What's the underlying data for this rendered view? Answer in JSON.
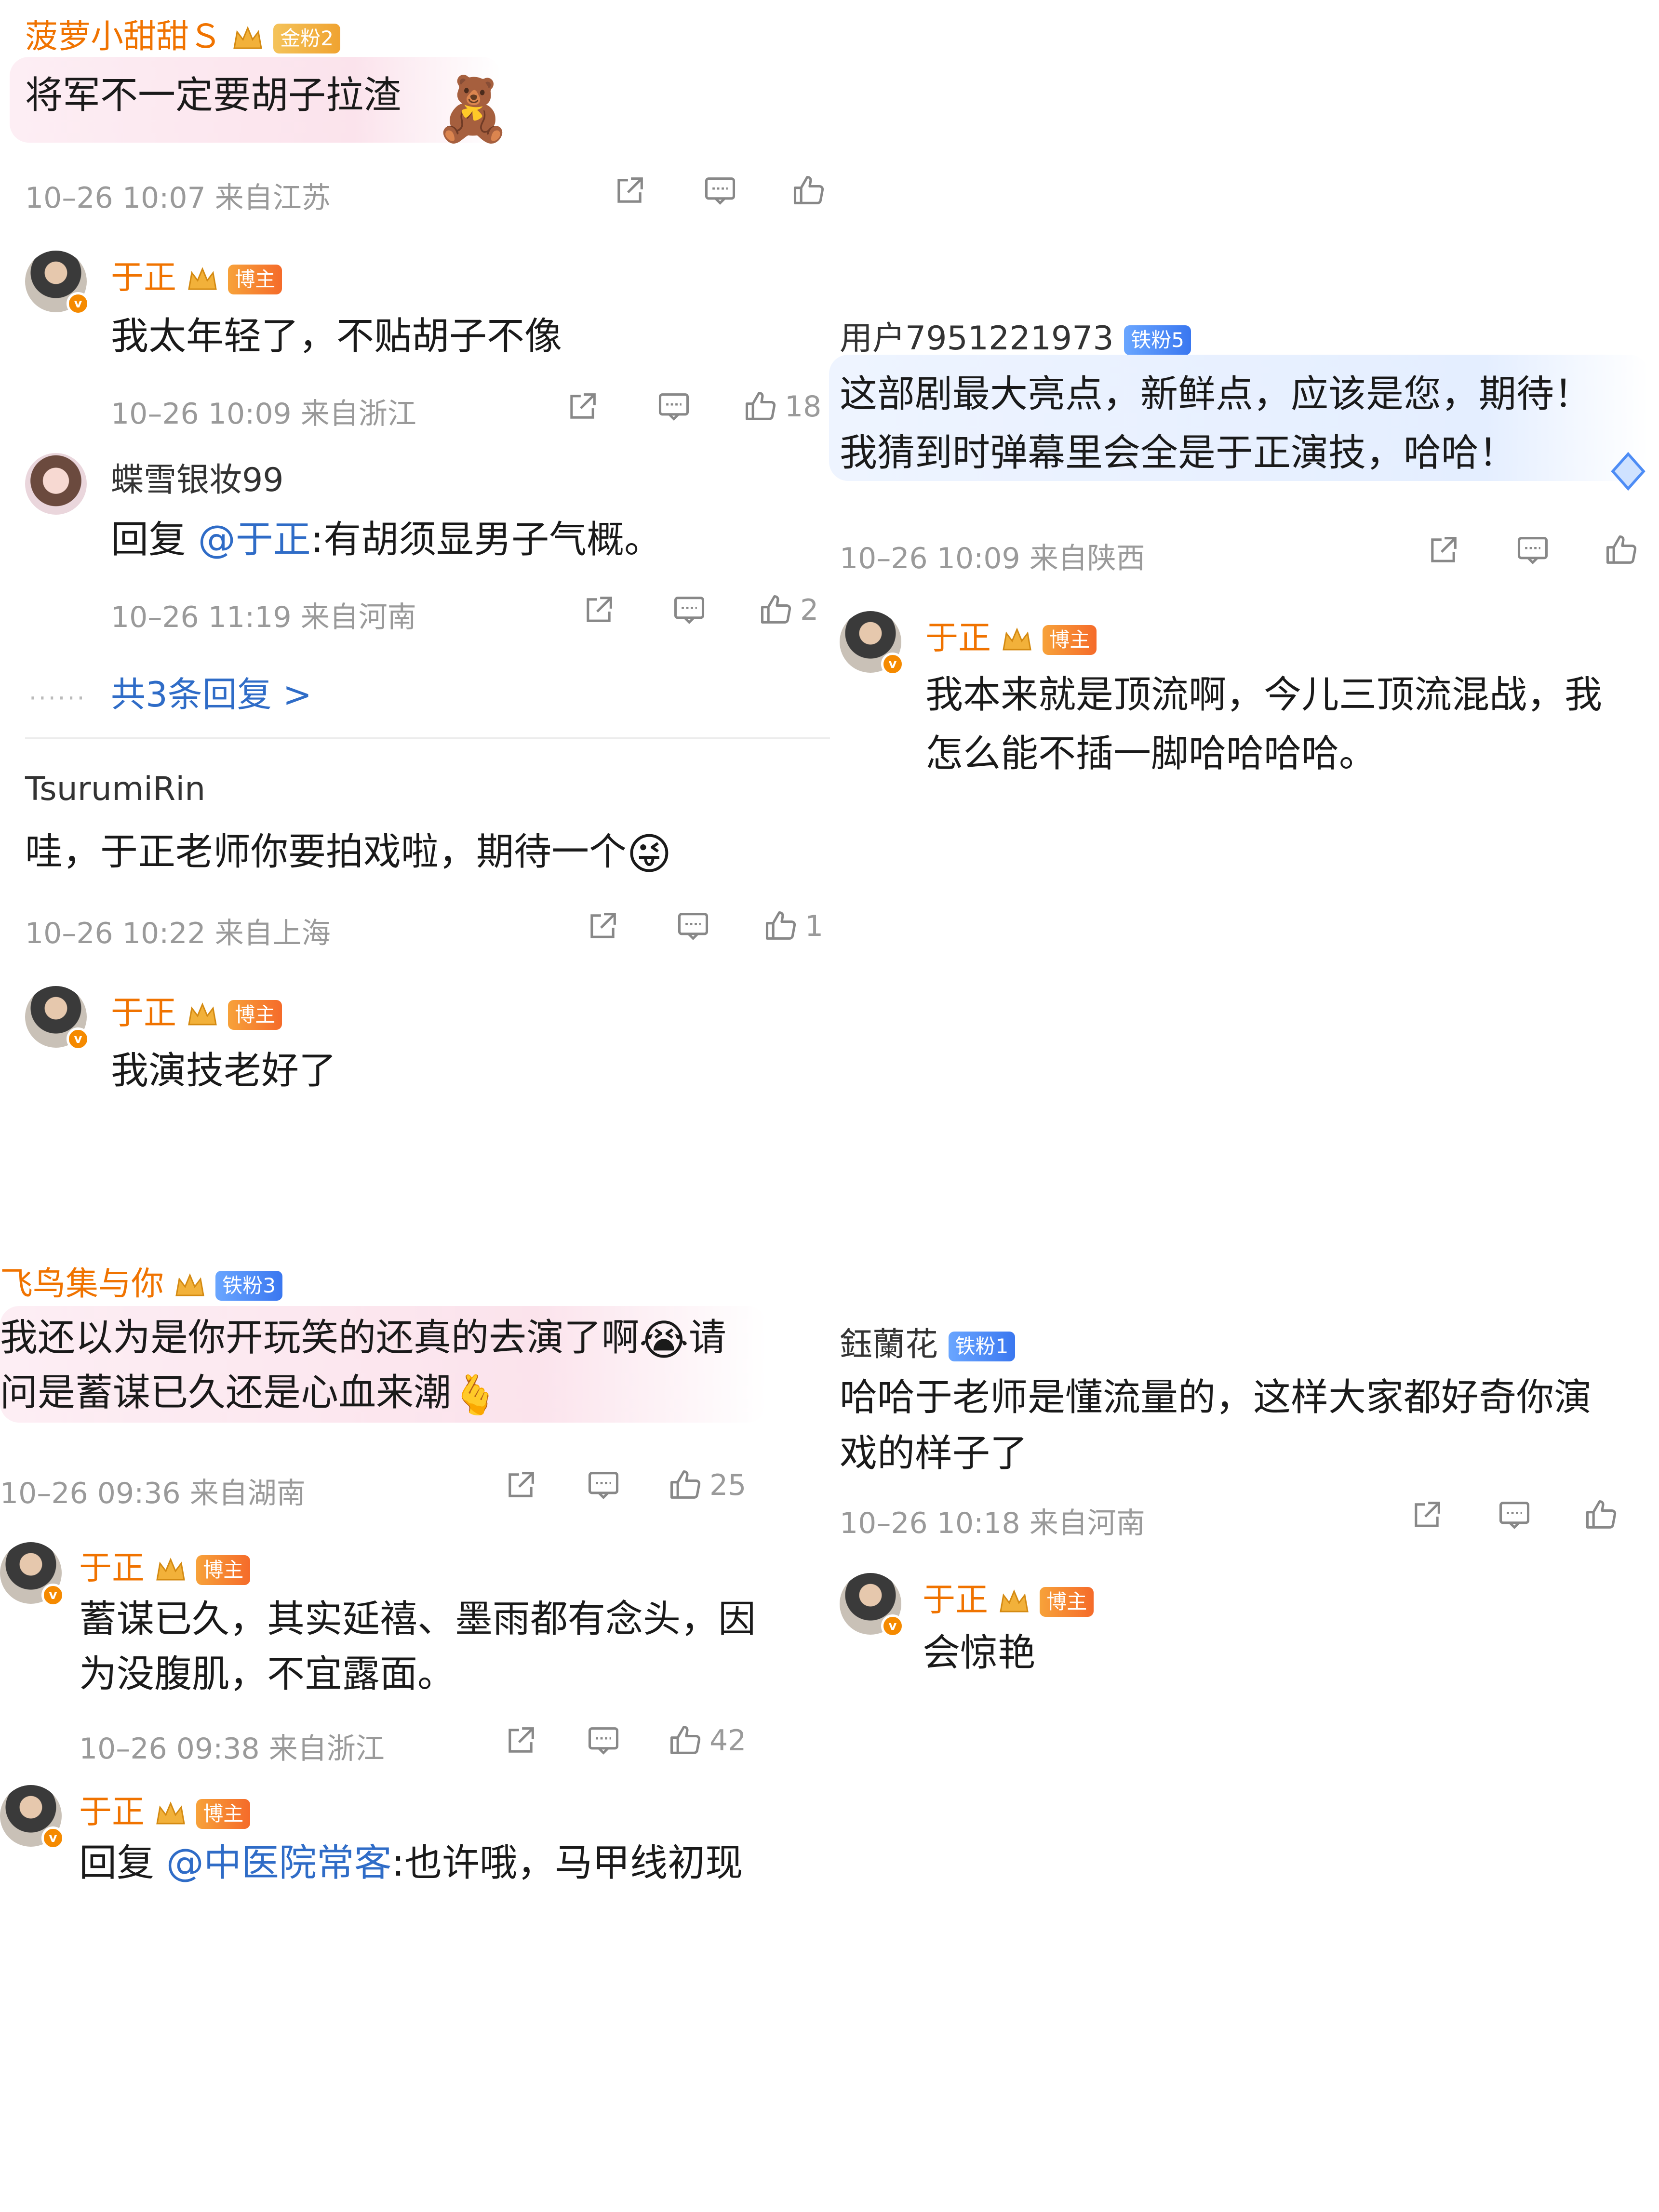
{
  "colors": {
    "name_orange": "#f07300",
    "mention_blue": "#2f6cc7",
    "meta_gray": "#9a9a9a",
    "vip_orange": "#f58a00"
  },
  "icons": [
    "share-icon",
    "comment-icon",
    "like-icon",
    "crown-icon",
    "verified-icon"
  ],
  "c1": {
    "user": "菠萝小甜甜Ｓ",
    "badge": "金粉2",
    "text": "将军不一定要胡子拉渣",
    "meta": "10–26 10:07 来自江苏",
    "reply1": {
      "user": "于正",
      "badge": "博主",
      "text": "我太年轻了，不贴胡子不像",
      "meta": "10–26 10:09 来自浙江",
      "likes": "18"
    },
    "reply2": {
      "user": "蝶雪银妆99",
      "prefix": "回复 ",
      "mention": "@于正",
      "text": ":有胡须显男子气概。",
      "meta": "10–26 11:19 来自河南",
      "likes": "2"
    },
    "more": "共3条回复 >"
  },
  "c2": {
    "user": "TsurumiRin",
    "text": "哇，于正老师你要拍戏啦，期待一个",
    "meta": "10–26 10:22 来自上海",
    "likes": "1",
    "reply1": {
      "user": "于正",
      "badge": "博主",
      "text": "我演技老好了"
    }
  },
  "c3": {
    "user": "用户7951221973",
    "badge": "铁粉5",
    "line1": "这部剧最大亮点，新鲜点，应该是您，期待！",
    "line2": "我猜到时弹幕里会全是于正演技，哈哈！",
    "meta": "10–26 10:09 来自陕西",
    "reply1": {
      "user": "于正",
      "badge": "博主",
      "line1": "我本来就是顶流啊，今儿三顶流混战，我",
      "line2": "怎么能不插一脚哈哈哈哈。"
    }
  },
  "c4": {
    "user": "飞鸟集与你",
    "badge": "铁粉3",
    "line1a": "我还以为是你开玩笑的还真的去演了啊",
    "line1b": "请",
    "line2": "问是蓄谋已久还是心血来潮",
    "meta": "10–26 09:36 来自湖南",
    "likes": "25",
    "reply1": {
      "user": "于正",
      "badge": "博主",
      "line1": "蓄谋已久，其实延禧、墨雨都有念头，因",
      "line2": "为没腹肌，不宜露面。",
      "meta": "10–26 09:38 来自浙江",
      "likes": "42"
    },
    "reply2": {
      "user": "于正",
      "badge": "博主",
      "prefix": "回复 ",
      "mention": "@中医院常客",
      "text": ":也许哦，马甲线初现"
    }
  },
  "c5": {
    "user": "鈺蘭花",
    "badge": "铁粉1",
    "line1": "哈哈于老师是懂流量的，这样大家都好奇你演",
    "line2": "戏的样子了",
    "meta": "10–26 10:18 来自河南",
    "reply1": {
      "user": "于正",
      "badge": "博主",
      "text": "会惊艳"
    }
  }
}
